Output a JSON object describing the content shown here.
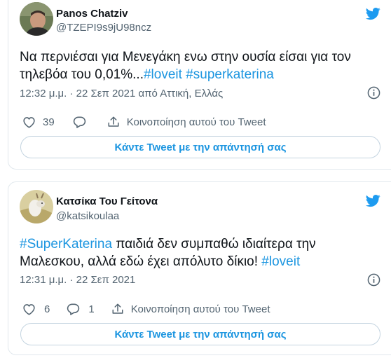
{
  "tweets": [
    {
      "author_name": "Panos Chatziv",
      "handle": "@TZEPI9s9jU98ncz",
      "text_plain": "Να περνιέσαι για Μενεγάκη ενω στην ουσία είσαι για τον τηλεβόα του 0,01%...",
      "hashtags": [
        "#loveit",
        "#superkaterina"
      ],
      "timestamp": "12:32 μ.μ. · 22 Σεπ 2021 από Αττική, Ελλάς",
      "likes": "39",
      "replies": "",
      "share_label": "Κοινοποίηση αυτού του Tweet",
      "reply_button": "Κάντε Tweet με την απάντησή σας"
    },
    {
      "author_name": "Κατσίκα Του Γείτονα",
      "handle": "@katsikoulaa",
      "hashtag_start": "#SuperKaterina",
      "text_line1_rest": " παιδιά δεν συμπαθώ ιδιαίτερα την",
      "text_line2": "Μαλεσκου, αλλά εδώ έχει απόλυτο δίκιο! ",
      "hashtag_end": "#loveit",
      "timestamp": "12:31 μ.μ. · 22 Σεπ 2021",
      "likes": "6",
      "replies": "1",
      "share_label": "Κοινοποίηση αυτού του Tweet",
      "reply_button": "Κάντε Tweet με την απάντησή σας"
    }
  ],
  "colors": {
    "accent": "#1b95e0",
    "twitter_blue": "#1d9bf0",
    "muted": "#536471",
    "border": "#e1e8ed"
  },
  "icons": [
    "twitter-bird-icon",
    "info-icon",
    "heart-icon",
    "reply-bubble-icon",
    "share-icon"
  ]
}
